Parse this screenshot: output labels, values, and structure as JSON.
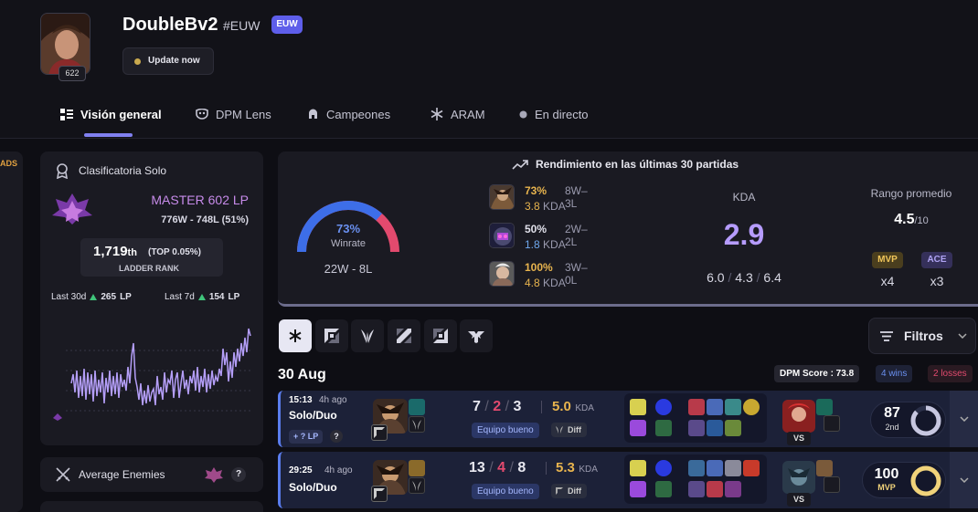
{
  "profile": {
    "name": "DoubleBv2",
    "tag": "#EUW",
    "region": "EUW",
    "level": "622",
    "update_label": "Update now"
  },
  "tabs": [
    {
      "label": "Visión general",
      "icon": "list-icon"
    },
    {
      "label": "DPM Lens",
      "icon": "mask-icon"
    },
    {
      "label": "Campeones",
      "icon": "helmet-icon"
    },
    {
      "label": "ARAM",
      "icon": "snowflake-icon"
    },
    {
      "label": "En directo",
      "icon": "live-dot-icon"
    }
  ],
  "left_stub_label": "ADS",
  "ranked": {
    "title": "Clasificatoria Solo",
    "tier": "MASTER 602 LP",
    "record": "776W - 748L (51%)",
    "ladder_position": "1,719",
    "ladder_suffix": "th",
    "top_pct": "(TOP 0.05%)",
    "ladder_label": "LADDER RANK",
    "last30_label": "Last 30d",
    "last30_value": "265",
    "last7_label": "Last 7d",
    "last7_value": "154",
    "lp_unit": "LP"
  },
  "average_enemies_label": "Average Enemies",
  "performance": {
    "title": "Rendimiento en las últimas 30 partidas",
    "winrate_pct": "73%",
    "winrate_value": 0.73,
    "winrate_label": "Winrate",
    "record": "22W - 8L",
    "champions": [
      {
        "pct": "73%",
        "record": "8W–3L",
        "kda": "3.8",
        "kda_label": "KDA"
      },
      {
        "pct": "50%",
        "record": "2W–2L",
        "kda": "1.8",
        "kda_label": "KDA"
      },
      {
        "pct": "100%",
        "record": "3W–0L",
        "kda": "4.8",
        "kda_label": "KDA"
      }
    ],
    "kda_title": "KDA",
    "kda_value": "2.9",
    "kda_k": "6.0",
    "kda_d": "4.3",
    "kda_a": "6.4",
    "kda_sep": "/",
    "avg_rank_title": "Rango promedio",
    "avg_rank_value": "4.5",
    "avg_rank_suffix": "/10",
    "mvp_label": "MVP",
    "mvp_count": "x4",
    "ace_label": "ACE",
    "ace_count": "x3"
  },
  "filters_label": "Filtros",
  "day": {
    "date": "30 Aug",
    "dpm_score": "DPM Score : 73.8",
    "wins": "4 wins",
    "losses": "2 losses"
  },
  "matches": [
    {
      "duration": "15:13",
      "ago": "4h ago",
      "queue": "Solo/Duo",
      "lp_change": "+ ? LP",
      "k": "7",
      "d": "2",
      "a": "3",
      "kda": "5.0",
      "kda_label": "KDA",
      "team_badge": "Equipo bueno",
      "diff_badge": "Diff",
      "vs_label": "VS",
      "score": "87",
      "score_rank": "2nd",
      "score_value": 0.87,
      "score_color": "#c7c7e0"
    },
    {
      "duration": "29:25",
      "ago": "4h ago",
      "queue": "Solo/Duo",
      "lp_change": "",
      "k": "13",
      "d": "4",
      "a": "8",
      "kda": "5.3",
      "kda_label": "KDA",
      "team_badge": "Equipo bueno",
      "diff_badge": "Diff",
      "vs_label": "VS",
      "score": "100",
      "score_rank": "MVP",
      "score_value": 1.0,
      "score_color": "#f1d37a"
    }
  ],
  "colors": {
    "accent": "#8080f0",
    "win_blue": "#5a7dee",
    "loss_red": "#e24a6e",
    "gold": "#e8b44e",
    "kda_purple": "#b69cff",
    "lp_green": "#3fc47a"
  }
}
